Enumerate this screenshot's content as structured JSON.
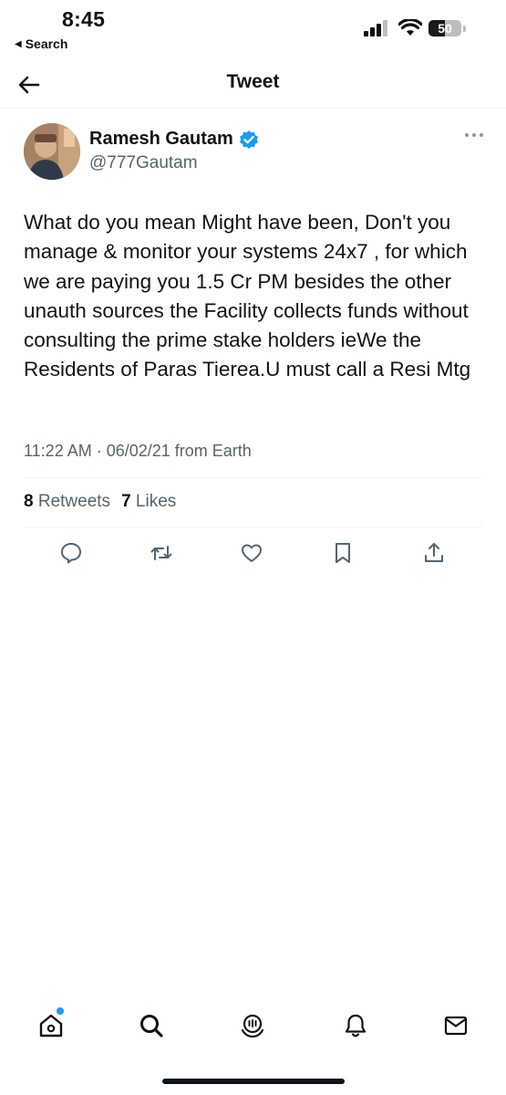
{
  "status_bar": {
    "time": "8:45",
    "back_app": "Search",
    "battery_percent": "50",
    "battery_level": 0.5
  },
  "header": {
    "title": "Tweet"
  },
  "tweet": {
    "author_name": "Ramesh Gautam",
    "author_handle": "@777Gautam",
    "verified": true,
    "text": "What do you mean Might have been, Don't you manage & monitor your systems 24x7 , for which we are paying you 1.5 Cr PM besides the other unauth sources the Facility collects funds without consulting the prime stake holders ieWe the Residents of Paras Tierea.U must call a Resi Mtg",
    "meta": "11:22 AM · 06/02/21 from Earth",
    "retweets_count": "8",
    "retweets_label": "Retweets",
    "likes_count": "7",
    "likes_label": "Likes"
  },
  "actions": [
    "reply-icon",
    "retweet-icon",
    "like-icon",
    "bookmark-icon",
    "share-icon"
  ],
  "tab_bar": [
    "home-icon",
    "search-icon",
    "spaces-icon",
    "notifications-icon",
    "messages-icon"
  ],
  "colors": {
    "accent": "#1d9bf0",
    "text": "#0f1419",
    "secondary": "#536471",
    "divider": "#eff3f4"
  }
}
